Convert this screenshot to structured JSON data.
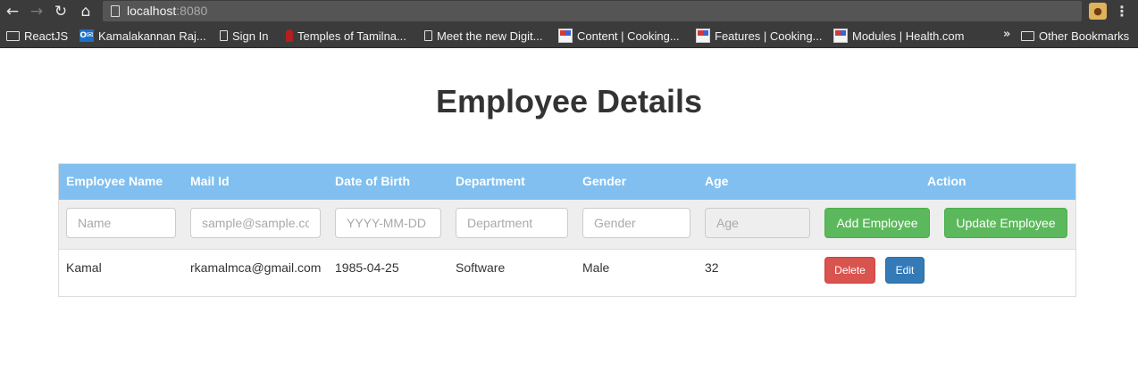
{
  "browser": {
    "url_host": "localhost",
    "url_port": ":8080",
    "bookmarks": [
      {
        "label": "ReactJS",
        "icon": "folder-icon"
      },
      {
        "label": "Kamalakannan Raj...",
        "icon": "outlook-icon"
      },
      {
        "label": "Sign In",
        "icon": "page-icon"
      },
      {
        "label": "Temples of Tamilna...",
        "icon": "temple-icon"
      },
      {
        "label": "Meet the new Digit...",
        "icon": "page-icon"
      },
      {
        "label": "Content | Cooking...",
        "icon": "htm-icon"
      },
      {
        "label": "Features | Cooking...",
        "icon": "htm-icon"
      },
      {
        "label": "Modules | Health.com",
        "icon": "htm-icon"
      }
    ],
    "overflow_label": "»",
    "other_bookmarks": "Other Bookmarks"
  },
  "page": {
    "title": "Employee Details"
  },
  "table": {
    "headers": [
      "Employee Name",
      "Mail Id",
      "Date of Birth",
      "Department",
      "Gender",
      "Age",
      "Action"
    ],
    "form": {
      "name_placeholder": "Name",
      "mail_placeholder": "sample@sample.com",
      "dob_placeholder": "YYYY-MM-DD",
      "department_placeholder": "Department",
      "gender_placeholder": "Gender",
      "age_placeholder": "Age",
      "add_label": "Add Employee",
      "update_label": "Update Employee"
    },
    "rows": [
      {
        "name": "Kamal",
        "mail": "rkamalmca@gmail.com",
        "dob": "1985-04-25",
        "department": "Software",
        "gender": "Male",
        "age": "32",
        "delete_label": "Delete",
        "edit_label": "Edit"
      }
    ]
  },
  "colors": {
    "header_bg": "#80bfef",
    "success": "#5cb85c",
    "danger": "#d9534f",
    "primary": "#337ab7"
  }
}
